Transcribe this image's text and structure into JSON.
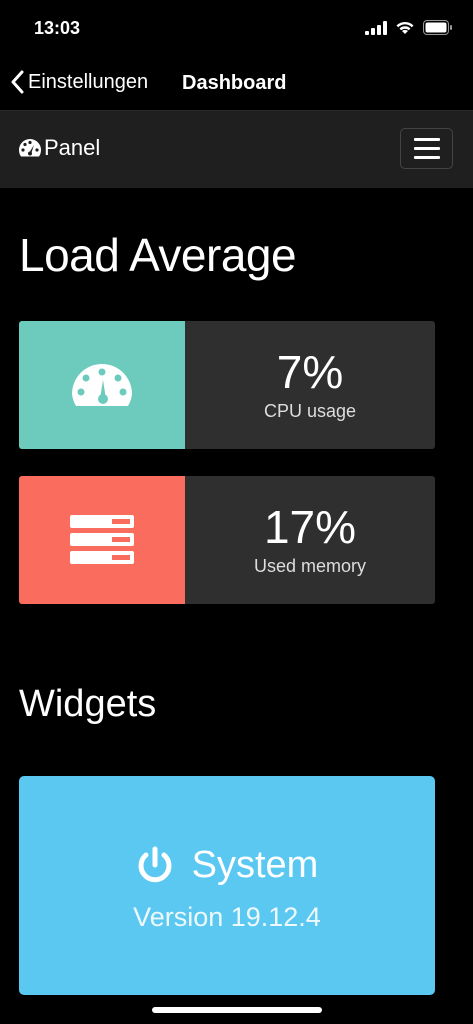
{
  "status_bar": {
    "time": "13:03"
  },
  "nav": {
    "back_label": "Einstellungen",
    "title": "Dashboard"
  },
  "panel": {
    "brand": "Panel"
  },
  "load_average": {
    "title": "Load Average",
    "cpu": {
      "value": "7%",
      "label": "CPU usage",
      "icon": "tachometer-icon",
      "color": "#6ccbbd"
    },
    "memory": {
      "value": "17%",
      "label": "Used memory",
      "icon": "server-icon",
      "color": "#fa6d5e"
    }
  },
  "widgets": {
    "title": "Widgets",
    "system": {
      "title": "System",
      "version": "Version 19.12.4",
      "icon": "power-icon",
      "color": "#5bc8f2"
    }
  }
}
